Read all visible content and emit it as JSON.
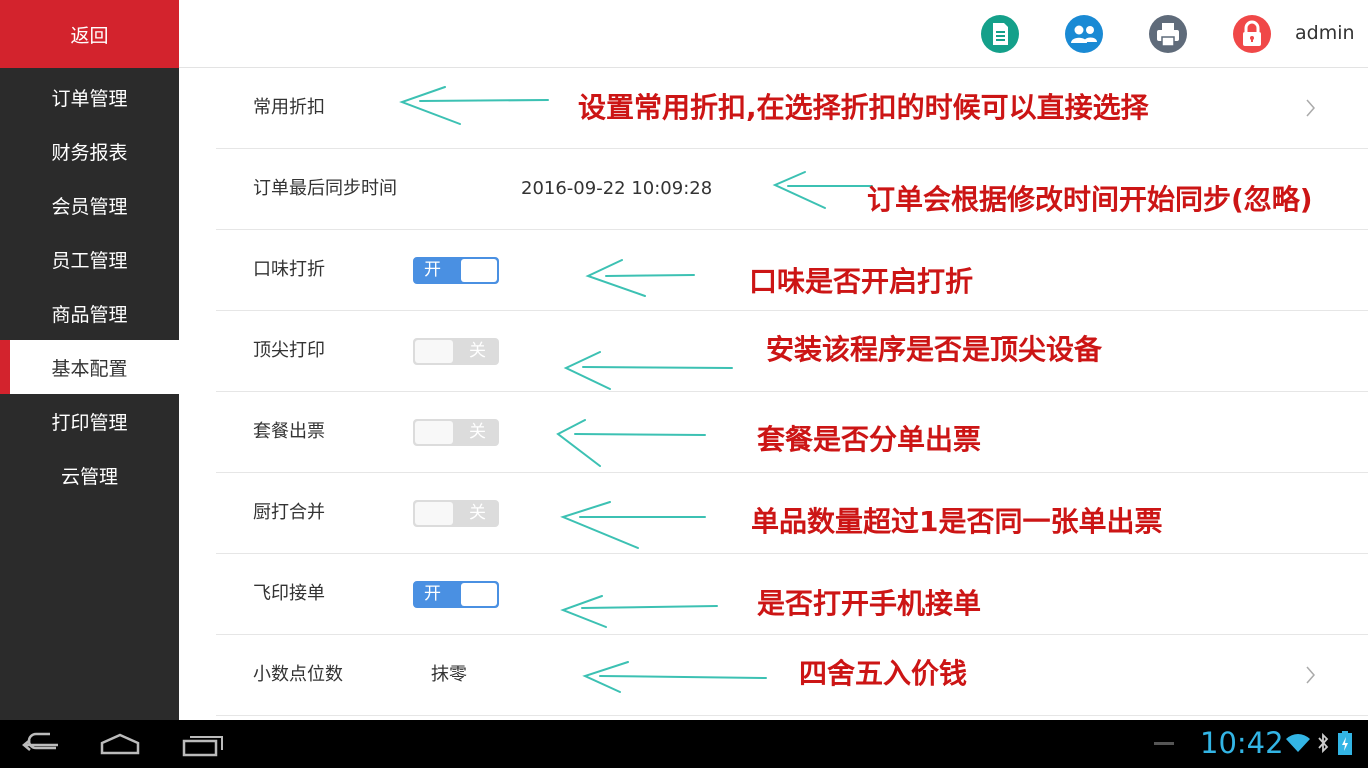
{
  "sidebar": {
    "back_label": "返回",
    "items": [
      {
        "label": "订单管理"
      },
      {
        "label": "财务报表"
      },
      {
        "label": "会员管理"
      },
      {
        "label": "员工管理"
      },
      {
        "label": "商品管理"
      },
      {
        "label": "基本配置",
        "active": true
      },
      {
        "label": "打印管理"
      },
      {
        "label": "云管理"
      }
    ]
  },
  "header": {
    "icons": [
      "document-icon",
      "users-icon",
      "printer-icon",
      "lock-icon"
    ],
    "username": "admin"
  },
  "settings": [
    {
      "label": "常用折扣",
      "kind": "link"
    },
    {
      "label": "订单最后同步时间",
      "value": "2016-09-22 10:09:28"
    },
    {
      "label": "口味打折",
      "toggle": "开",
      "on": true
    },
    {
      "label": "顶尖打印",
      "toggle": "关",
      "on": false
    },
    {
      "label": "套餐出票",
      "toggle": "关",
      "on": false
    },
    {
      "label": "厨打合并",
      "toggle": "关",
      "on": false
    },
    {
      "label": "飞印接单",
      "toggle": "开",
      "on": true
    },
    {
      "label": "小数点位数",
      "value": "抹零",
      "kind": "link"
    }
  ],
  "annotations": [
    "设置常用折扣,在选择折扣的时候可以直接选择",
    "订单会根据修改时间开始同步(忽略)",
    "口味是否开启打折",
    "安装该程序是否是顶尖设备",
    "套餐是否分单出票",
    "单品数量超过1是否同一张单出票",
    "是否打开手机接单",
    "四舍五入价钱"
  ],
  "statusbar": {
    "time": "10:42"
  },
  "colors": {
    "brand_red": "#d3232d",
    "sidebar_bg": "#2b2b2b",
    "toggle_on": "#4a90e2",
    "header_icon": "#14a08a",
    "annotation_red": "#cc1515",
    "arrow": "#3cc1b3",
    "clock": "#33b5e5"
  }
}
